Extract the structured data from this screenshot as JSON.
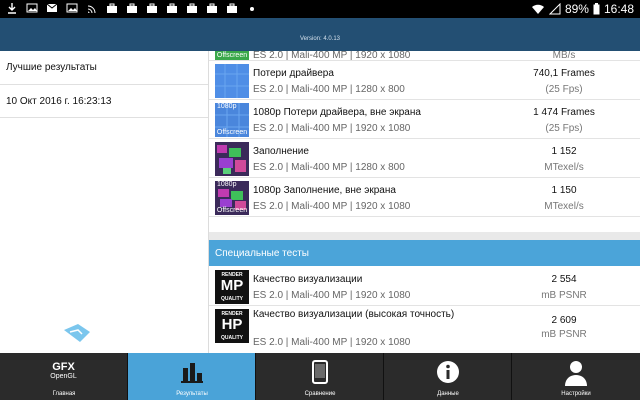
{
  "statusbar": {
    "battery": "89%",
    "time": "16:48"
  },
  "header": {
    "version": "Version: 4.0.13"
  },
  "left_panel": {
    "title": "Лучшие результаты",
    "datetime": "10 Окт 2016 г. 16:23:13"
  },
  "results": [
    {
      "name": "",
      "spec": "ES 2.0 | Mali-400 MP | 1920 x 1080",
      "value": "",
      "unit": "MB/s",
      "thumb": "offscreen-green-icon",
      "thumb_label": "Offscreen",
      "thumb_tag": ""
    },
    {
      "name": "Потери драйвера",
      "spec": "ES 2.0 | Mali-400 MP | 1280 x 800",
      "value": "740,1 Frames",
      "unit": "(25 Fps)",
      "thumb": "driver-overhead-icon",
      "thumb_label": "",
      "thumb_tag": ""
    },
    {
      "name": "1080p Потери драйвера, вне экрана",
      "spec": "ES 2.0 | Mali-400 MP | 1920 x 1080",
      "value": "1 474 Frames",
      "unit": "(25 Fps)",
      "thumb": "driver-overhead-offscreen-icon",
      "thumb_label": "Offscreen",
      "thumb_tag": "1080p"
    },
    {
      "name": "Заполнение",
      "spec": "ES 2.0 | Mali-400 MP | 1280 x 800",
      "value": "1 152",
      "unit": "MTexel/s",
      "thumb": "fill-rate-icon",
      "thumb_label": "",
      "thumb_tag": ""
    },
    {
      "name": "1080p Заполнение, вне экрана",
      "spec": "ES 2.0 | Mali-400 MP | 1920 x 1080",
      "value": "1 150",
      "unit": "MTexel/s",
      "thumb": "fill-rate-offscreen-icon",
      "thumb_label": "Offscreen",
      "thumb_tag": "1080p"
    }
  ],
  "special_section": {
    "title": "Специальные тесты",
    "items": [
      {
        "name": "Качество визуализации",
        "spec": "ES 2.0 | Mali-400 MP | 1920 x 1080",
        "value": "2 554",
        "unit": "mB PSNR",
        "badge_top": "RENDER",
        "badge_main": "MP",
        "badge_bottom": "QUALITY"
      },
      {
        "name": "Качество визуализации (высокая точность)",
        "spec": "ES 2.0 | Mali-400 MP | 1920 x 1080",
        "value": "2 609",
        "unit": "mB PSNR",
        "badge_top": "RENDER",
        "badge_main": "HP",
        "badge_bottom": "QUALITY"
      }
    ]
  },
  "bottom_nav": [
    {
      "label": "Главная",
      "logo_top": "GFX",
      "logo_bottom": "OpenGL",
      "icon": "gfx-logo-icon"
    },
    {
      "label": "Результаты",
      "icon": "bar-chart-icon"
    },
    {
      "label": "Сравнение",
      "icon": "phone-icon"
    },
    {
      "label": "Данные",
      "icon": "info-icon"
    },
    {
      "label": "Настройки",
      "icon": "user-icon"
    }
  ],
  "colors": {
    "header": "#234f73",
    "accent": "#4ba4d9",
    "nav_bg": "#2b2b2b"
  }
}
